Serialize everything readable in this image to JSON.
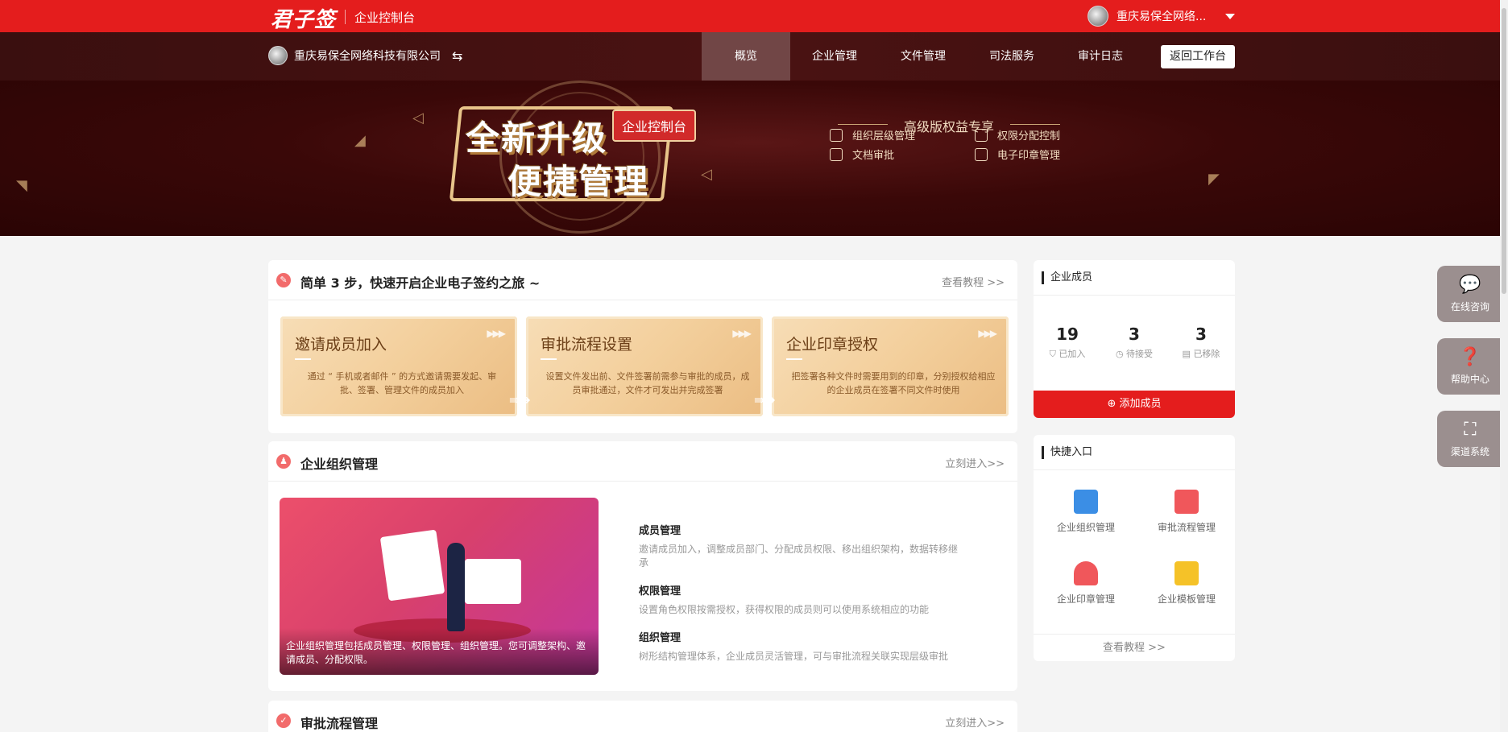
{
  "topbar": {
    "logo": "君子签",
    "title": "企业控制台",
    "user_name": "重庆易保全网络..."
  },
  "navbar": {
    "company": "重庆易保全网络科技有限公司",
    "items": [
      "概览",
      "企业管理",
      "文件管理",
      "司法服务",
      "审计日志"
    ],
    "back_label": "返回工作台"
  },
  "banner": {
    "line1": "全新升级",
    "line2": "便捷管理",
    "tag": "企业控制台",
    "perk_head": "高级版权益专享",
    "perks": [
      "组织层级管理",
      "权限分配控制",
      "文档审批",
      "电子印章管理"
    ]
  },
  "steps": {
    "title": "简单 3 步，快速开启企业电子签约之旅 ~",
    "link": "查看教程 >>",
    "items": [
      {
        "title": "邀请成员加入",
        "desc": "通过 “ 手机或者邮件 ” 的方式邀请需要发起、审批、签署、管理文件的成员加入"
      },
      {
        "title": "审批流程设置",
        "desc": "设置文件发出前、文件签署前需参与审批的成员，成员审批通过，文件才可发出并完成签署"
      },
      {
        "title": "企业印章授权",
        "desc": "把签署各种文件时需要用到的印章，分别授权给相应的企业成员在签署不同文件时使用"
      }
    ]
  },
  "org": {
    "title": "企业组织管理",
    "link": "立刻进入>>",
    "caption": "企业组织管理包括成员管理、权限管理、组织管理。您可调整架构、邀请成员、分配权限。",
    "items": [
      {
        "title": "成员管理",
        "desc": "邀请成员加入，调整成员部门、分配成员权限、移出组织架构，数据转移继承"
      },
      {
        "title": "权限管理",
        "desc": "设置角色权限按需授权，获得权限的成员则可以使用系统相应的功能"
      },
      {
        "title": "组织管理",
        "desc": "树形结构管理体系，企业成员灵活管理，可与审批流程关联实现层级审批"
      }
    ]
  },
  "approval": {
    "title": "审批流程管理",
    "link": "立刻进入>>"
  },
  "members": {
    "title": "企业成员",
    "stats": [
      {
        "num": "19",
        "label": "已加入"
      },
      {
        "num": "3",
        "label": "待接受"
      },
      {
        "num": "3",
        "label": "已移除"
      }
    ],
    "add_label": "添加成员"
  },
  "quick": {
    "title": "快捷入口",
    "items": [
      "企业组织管理",
      "审批流程管理",
      "企业印章管理",
      "企业模板管理"
    ],
    "more": "查看教程 >>"
  },
  "float": [
    "在线咨询",
    "帮助中心",
    "渠道系统"
  ],
  "colors": {
    "brand_red": "#e41d1d",
    "nav_dark": "#3a0f0f",
    "gold": "#f3cf9c"
  }
}
